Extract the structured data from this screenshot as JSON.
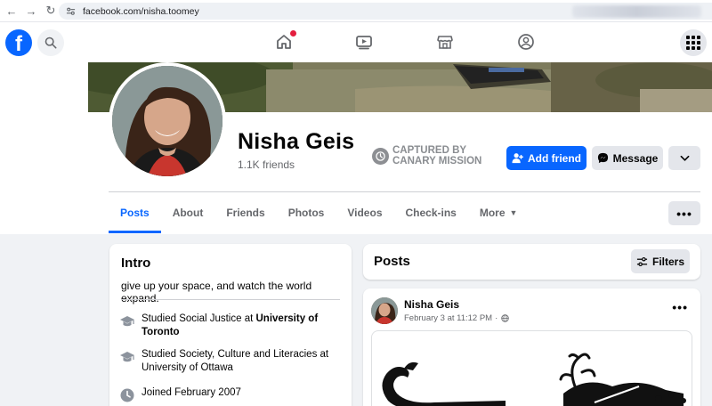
{
  "browser": {
    "url": "facebook.com/nisha.toomey",
    "back_icon": "back-arrow-icon",
    "forward_icon": "forward-arrow-icon",
    "reload_icon": "reload-icon"
  },
  "topbar": {
    "logo_letter": "f",
    "brand_color": "#0866ff",
    "nav_icons": [
      "home-icon",
      "watch-icon",
      "marketplace-icon",
      "groups-icon"
    ],
    "has_home_notification": true
  },
  "profile": {
    "name": "Nisha Geis",
    "friends": "1.1K friends",
    "captured_text": "CAPTURED BY CANARY MISSION",
    "add_friend_label": "Add friend",
    "message_label": "Message"
  },
  "tabs": [
    {
      "label": "Posts",
      "active": true
    },
    {
      "label": "About",
      "active": false
    },
    {
      "label": "Friends",
      "active": false
    },
    {
      "label": "Photos",
      "active": false
    },
    {
      "label": "Videos",
      "active": false
    },
    {
      "label": "Check-ins",
      "active": false
    },
    {
      "label": "More",
      "active": false
    }
  ],
  "intro": {
    "title": "Intro",
    "bio": "give up your space, and watch the world expand.",
    "edu1_prefix": "Studied Social Justice at ",
    "edu1_school": "University of Toronto",
    "edu2": "Studied Society, Culture and Literacies at University of Ottawa",
    "joined": "Joined February 2007"
  },
  "posts": {
    "title": "Posts",
    "filters_label": "Filters",
    "post": {
      "author": "Nisha Geis",
      "date": "February 3 at 11:12 PM",
      "separator": "·"
    }
  }
}
